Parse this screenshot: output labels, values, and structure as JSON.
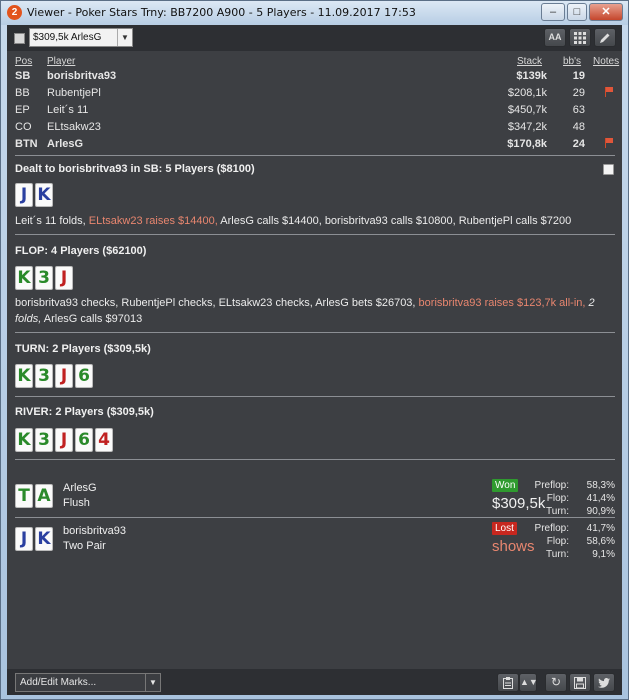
{
  "window": {
    "title": "Viewer - Poker Stars Trny: BB7200 A900 - 5 Players - 11.09.2017 17:53",
    "app_icon": "2",
    "minimize": "–",
    "maximize": "□",
    "close": "✕"
  },
  "toolbar": {
    "hand_select_value": "$309,5k ArlesG",
    "font_btn": "AA",
    "grid_icon": "grid-icon",
    "edit_icon": "pencil-icon"
  },
  "players": {
    "headers": {
      "pos": "Pos",
      "player": "Player",
      "stack": "Stack",
      "bbs": "bb's",
      "notes": "Notes"
    },
    "rows": [
      {
        "pos": "SB",
        "name": "borisbritva93",
        "stack": "$139k",
        "bbs": "19",
        "bold": true,
        "flag": false
      },
      {
        "pos": "BB",
        "name": "RubentjePl",
        "stack": "$208,1k",
        "bbs": "29",
        "bold": false,
        "flag": true
      },
      {
        "pos": "EP",
        "name": "Leit´s 11",
        "stack": "$450,7k",
        "bbs": "63",
        "bold": false,
        "flag": false
      },
      {
        "pos": "CO",
        "name": "ELtsakw23",
        "stack": "$347,2k",
        "bbs": "48",
        "bold": false,
        "flag": false
      },
      {
        "pos": "BTN",
        "name": "ArlesG",
        "stack": "$170,8k",
        "bbs": "24",
        "bold": true,
        "flag": true
      }
    ]
  },
  "preflop": {
    "title": "Dealt to borisbritva93 in SB: 5 Players ($8100)",
    "cards": [
      {
        "r": "J",
        "c": "blue"
      },
      {
        "r": "K",
        "c": "blue"
      }
    ],
    "a1": "Leit´s 11 folds, ",
    "a2": "ELtsakw23 raises $14400,",
    "a3": " ArlesG calls $14400, borisbritva93 calls $10800, RubentjePl calls $7200"
  },
  "flop": {
    "title": "FLOP: 4 Players ($62100)",
    "cards": [
      {
        "r": "K",
        "c": "green"
      },
      {
        "r": "3",
        "c": "green"
      },
      {
        "r": "J",
        "c": "red"
      }
    ],
    "a1": "borisbritva93 checks, RubentjePl checks, ELtsakw23 checks, ArlesG bets $26703, ",
    "a2": "borisbritva93 raises $123,7k all-in,",
    "a3": " 2 folds,",
    "a4": " ArlesG calls $97013"
  },
  "turn": {
    "title": "TURN: 2 Players ($309,5k)",
    "cards": [
      {
        "r": "K",
        "c": "green"
      },
      {
        "r": "3",
        "c": "green"
      },
      {
        "r": "J",
        "c": "red"
      },
      {
        "r": "6",
        "c": "green"
      }
    ]
  },
  "river": {
    "title": "RIVER: 2 Players ($309,5k)",
    "cards": [
      {
        "r": "K",
        "c": "green"
      },
      {
        "r": "3",
        "c": "green"
      },
      {
        "r": "J",
        "c": "red"
      },
      {
        "r": "6",
        "c": "green"
      },
      {
        "r": "4",
        "c": "red"
      }
    ]
  },
  "results": [
    {
      "name": "ArlesG",
      "hand": "Flush",
      "badge": "Won",
      "amount": "$309,5k",
      "cards": [
        {
          "r": "T",
          "c": "green"
        },
        {
          "r": "A",
          "c": "green"
        }
      ],
      "eq": {
        "preflop_label": "Preflop:",
        "preflop": "58,3%",
        "flop_label": "Flop:",
        "flop": "41,4%",
        "turn_label": "Turn:",
        "turn": "90,9%"
      }
    },
    {
      "name": "borisbritva93",
      "hand": "Two Pair",
      "badge": "Lost",
      "amount": "shows",
      "cards": [
        {
          "r": "J",
          "c": "blue"
        },
        {
          "r": "K",
          "c": "blue"
        }
      ],
      "eq": {
        "preflop_label": "Preflop:",
        "preflop": "41,7%",
        "flop_label": "Flop:",
        "flop": "58,6%",
        "turn_label": "Turn:",
        "turn": "9,1%"
      }
    }
  ],
  "bottom": {
    "marks_placeholder": "Add/Edit Marks..."
  },
  "colors": {
    "accent_raise": "#e8866f",
    "won": "#2f9a2f",
    "lost": "#c7271f"
  }
}
